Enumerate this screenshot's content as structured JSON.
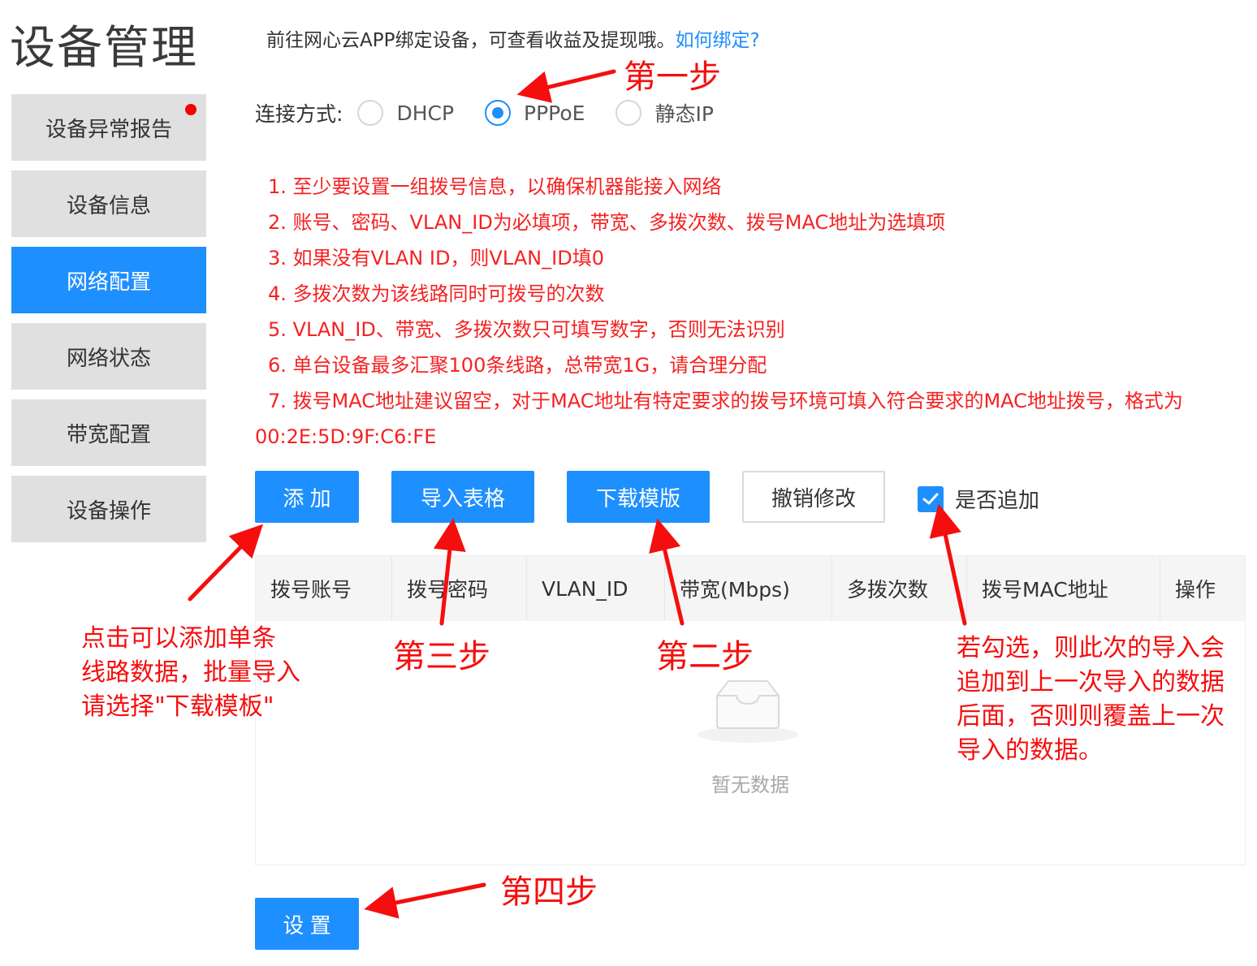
{
  "page": {
    "title": "设备管理"
  },
  "sidebar": {
    "items": [
      {
        "label": "设备异常报告",
        "alert": true
      },
      {
        "label": "设备信息"
      },
      {
        "label": "网络配置",
        "active": true
      },
      {
        "label": "网络状态"
      },
      {
        "label": "带宽配置"
      },
      {
        "label": "设备操作"
      }
    ]
  },
  "hint": {
    "text": "前往网心云APP绑定设备，可查看收益及提现哦。",
    "link": "如何绑定?"
  },
  "connection": {
    "label": "连接方式:",
    "options": [
      "DHCP",
      "PPPoE",
      "静态IP"
    ],
    "selected": "PPPoE"
  },
  "notes": [
    "1. 至少要设置一组拨号信息，以确保机器能接入网络",
    "2. 账号、密码、VLAN_ID为必填项，带宽、多拨次数、拨号MAC地址为选填项",
    "3. 如果没有VLAN ID，则VLAN_ID填0",
    "4. 多拨次数为该线路同时可拨号的次数",
    "5. VLAN_ID、带宽、多拨次数只可填写数字，否则无法识别",
    "6. 单台设备最多汇聚100条线路，总带宽1G，请合理分配",
    "7. 拨号MAC地址建议留空，对于MAC地址有特定要求的拨号环境可填入符合要求的MAC地址拨号，格式为00:2E:5D:9F:C6:FE"
  ],
  "toolbar": {
    "add": "添 加",
    "import": "导入表格",
    "download": "下载模版",
    "revert": "撤销修改",
    "append_label": "是否追加",
    "append_checked": true
  },
  "table": {
    "columns": [
      "拨号账号",
      "拨号密码",
      "VLAN_ID",
      "带宽(Mbps)",
      "多拨次数",
      "拨号MAC地址",
      "操作"
    ],
    "rows": [],
    "empty_text": "暂无数据"
  },
  "submit": {
    "label": "设 置"
  },
  "annotations": {
    "step1": "第一步",
    "step2": "第二步",
    "step3": "第三步",
    "step4": "第四步",
    "add_note": [
      "点击可以添加单条",
      "线路数据，批量导入",
      "请选择\"下载模板\""
    ],
    "append_note": [
      "若勾选，则此次的导入会",
      "追加到上一次导入的数据",
      "后面，否则则覆盖上一次",
      "导入的数据。"
    ]
  },
  "colors": {
    "primary": "#1e8ffe",
    "annotation": "#f50e0e",
    "note": "#f52222",
    "sidebar_bg": "#e0e0e0"
  }
}
